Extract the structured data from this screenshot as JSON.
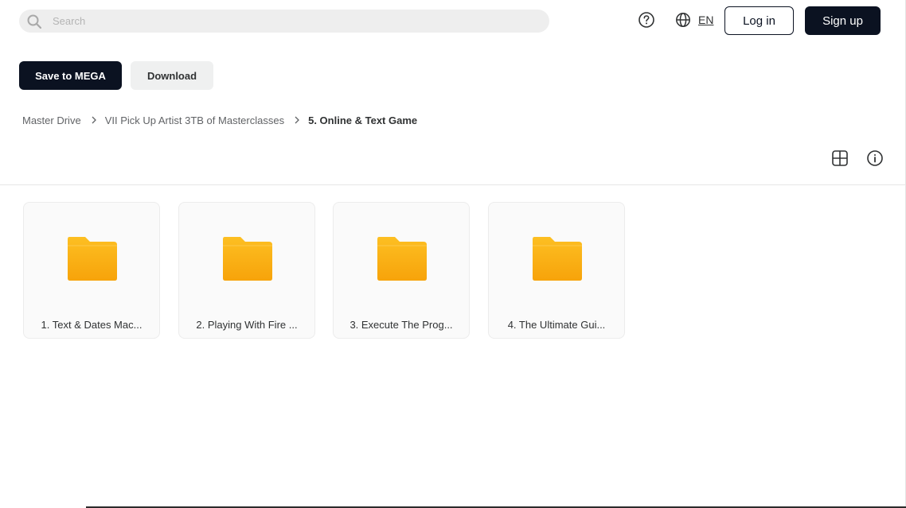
{
  "header": {
    "search": {
      "placeholder": "Search",
      "value": ""
    },
    "language": "EN",
    "login_label": "Log in",
    "signup_label": "Sign up"
  },
  "actions": {
    "save_label": "Save to MEGA",
    "download_label": "Download"
  },
  "breadcrumb": [
    "Master Drive",
    "VII Pick Up Artist 3TB of Masterclasses",
    "5. Online & Text Game"
  ],
  "folders": [
    {
      "name": "1. Text & Dates Mac..."
    },
    {
      "name": "2. Playing With Fire ..."
    },
    {
      "name": "3. Execute The Prog..."
    },
    {
      "name": "4. The Ultimate Gui..."
    }
  ],
  "icons": {
    "search": "search-icon",
    "help": "help-icon",
    "language": "globe-icon",
    "view_toggle": "grid-view-icon",
    "info": "info-icon",
    "folder": "folder-icon"
  },
  "colors": {
    "primary": "#0b1221",
    "secondary_button": "#eff0f0",
    "folder_top": "#fdbf22",
    "folder_bottom": "#f7a30a"
  }
}
